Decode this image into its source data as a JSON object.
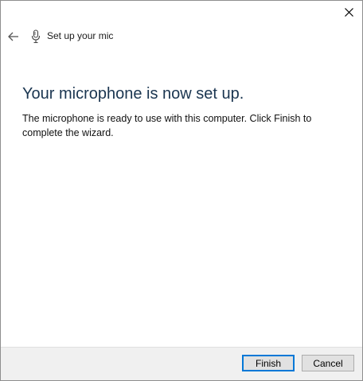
{
  "header": {
    "title": "Set up your mic"
  },
  "main": {
    "heading": "Your microphone is now set up.",
    "description": "The microphone is ready to use with this computer. Click Finish to complete the wizard."
  },
  "footer": {
    "finish_label": "Finish",
    "cancel_label": "Cancel"
  },
  "icons": {
    "close": "close-icon",
    "back": "back-arrow-icon",
    "mic": "microphone-icon"
  },
  "colors": {
    "heading": "#1a3550",
    "accent": "#0078d7",
    "footer_bg": "#f0f0f0"
  }
}
